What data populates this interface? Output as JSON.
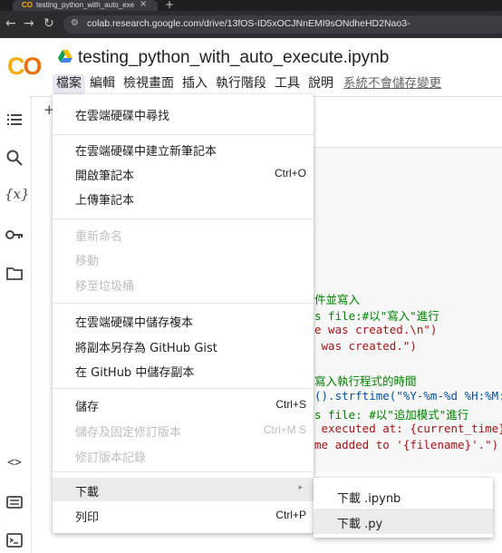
{
  "browser": {
    "tab_title": "testing_python_with_auto_exe",
    "url": "colab.research.google.com/drive/13fOS-ID5xOCJNnEMI9sONdheHD2Nao3-"
  },
  "notebook": {
    "title": "testing_python_with_auto_execute.ipynb",
    "logo_text": "CO"
  },
  "menubar": {
    "items": [
      "檔案",
      "編輯",
      "檢視畫面",
      "插入",
      "執行階段",
      "工具",
      "說明"
    ],
    "save_notice": "系統不會儲存變更"
  },
  "toolbar": {
    "add_label": "+"
  },
  "file_menu": {
    "items": [
      {
        "label": "在雲端硬碟中尋找",
        "shortcut": "",
        "enabled": true
      },
      {
        "label": "在雲端硬碟中建立新筆記本",
        "shortcut": "",
        "enabled": true
      },
      {
        "label": "開啟筆記本",
        "shortcut": "Ctrl+O",
        "enabled": true
      },
      {
        "label": "上傳筆記本",
        "shortcut": "",
        "enabled": true
      },
      {
        "label": "重新命名",
        "shortcut": "",
        "enabled": false
      },
      {
        "label": "移動",
        "shortcut": "",
        "enabled": false
      },
      {
        "label": "移至垃圾桶",
        "shortcut": "",
        "enabled": false
      },
      {
        "label": "在雲端硬碟中儲存複本",
        "shortcut": "",
        "enabled": true
      },
      {
        "label": "將副本另存為 GitHub Gist",
        "shortcut": "",
        "enabled": true
      },
      {
        "label": "在 GitHub 中儲存副本",
        "shortcut": "",
        "enabled": true
      },
      {
        "label": "儲存",
        "shortcut": "Ctrl+S",
        "enabled": true
      },
      {
        "label": "儲存及固定修訂版本",
        "shortcut": "Ctrl+M S",
        "enabled": false
      },
      {
        "label": "修訂版本記錄",
        "shortcut": "",
        "enabled": false
      },
      {
        "label": "下載",
        "shortcut": "",
        "enabled": true
      },
      {
        "label": "列印",
        "shortcut": "Ctrl+P",
        "enabled": true
      }
    ]
  },
  "download_submenu": {
    "items": [
      "下載 .ipynb",
      "下載 .py"
    ]
  },
  "code_lines": [
    {
      "text": "件並寫入",
      "cls": "cm"
    },
    {
      "text": "s file:#以\"寫入\"進行",
      "cls": "cm"
    },
    {
      "text": "e was created.\\n\")",
      "cls": "st"
    },
    {
      "text": " was created.\")",
      "cls": "st"
    },
    {
      "text": "寫入執行程式的時間",
      "cls": "cm"
    },
    {
      "text": "().strftime(\"%Y-%m-%d %H:%M:%S",
      "cls": "bl"
    },
    {
      "text": "s file: #以\"追加模式\"進行",
      "cls": "cm"
    },
    {
      "text": " executed at: {current_time}\\",
      "cls": "st"
    },
    {
      "text": "me added to '{filename}'.\")",
      "cls": "st"
    }
  ],
  "colors": {
    "logo_yellow": "#f9ab00",
    "logo_orange": "#e8710a",
    "menu_highlight": "#ebebeb"
  }
}
